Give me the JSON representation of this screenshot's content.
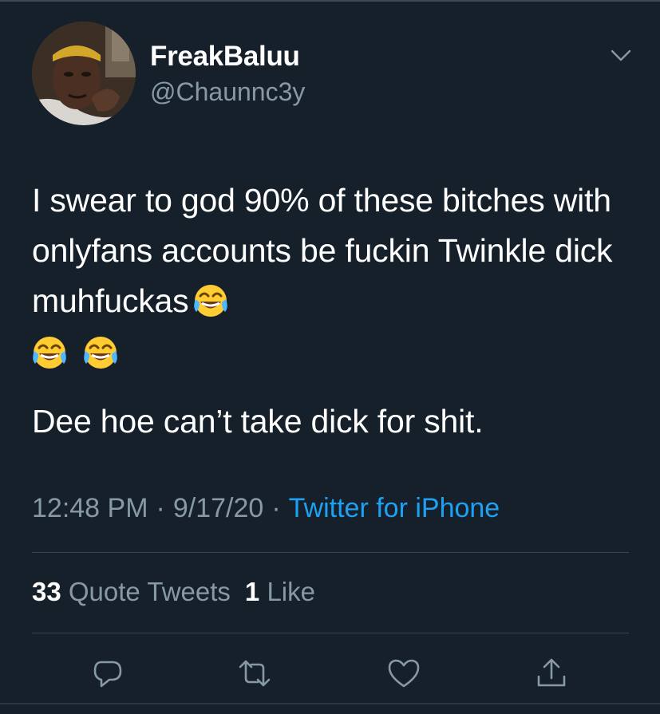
{
  "tweet": {
    "author": {
      "display_name": "FreakBaluu",
      "handle": "@Chaunnc3y"
    },
    "body": {
      "line1": "I swear to god 90% of these bitches with onlyfans accounts be fuckin Twinkle dick muhfuckas",
      "line2": "Dee hoe can’t take dick for shit."
    },
    "emoji": "face-with-tears-of-joy",
    "meta": {
      "time": "12:48 PM",
      "date": "9/17/20",
      "separator": "·",
      "source": "Twitter for iPhone"
    },
    "stats": {
      "quote_tweets_count": "33",
      "quote_tweets_label": "Quote Tweets",
      "likes_count": "1",
      "likes_label": "Like"
    },
    "actions": [
      "reply-icon",
      "retweet-icon",
      "like-icon",
      "share-icon"
    ]
  },
  "colors": {
    "background": "#15202b",
    "text": "#ffffff",
    "secondary": "#8899a6",
    "link": "#1da1f2",
    "divider": "#38444d"
  }
}
